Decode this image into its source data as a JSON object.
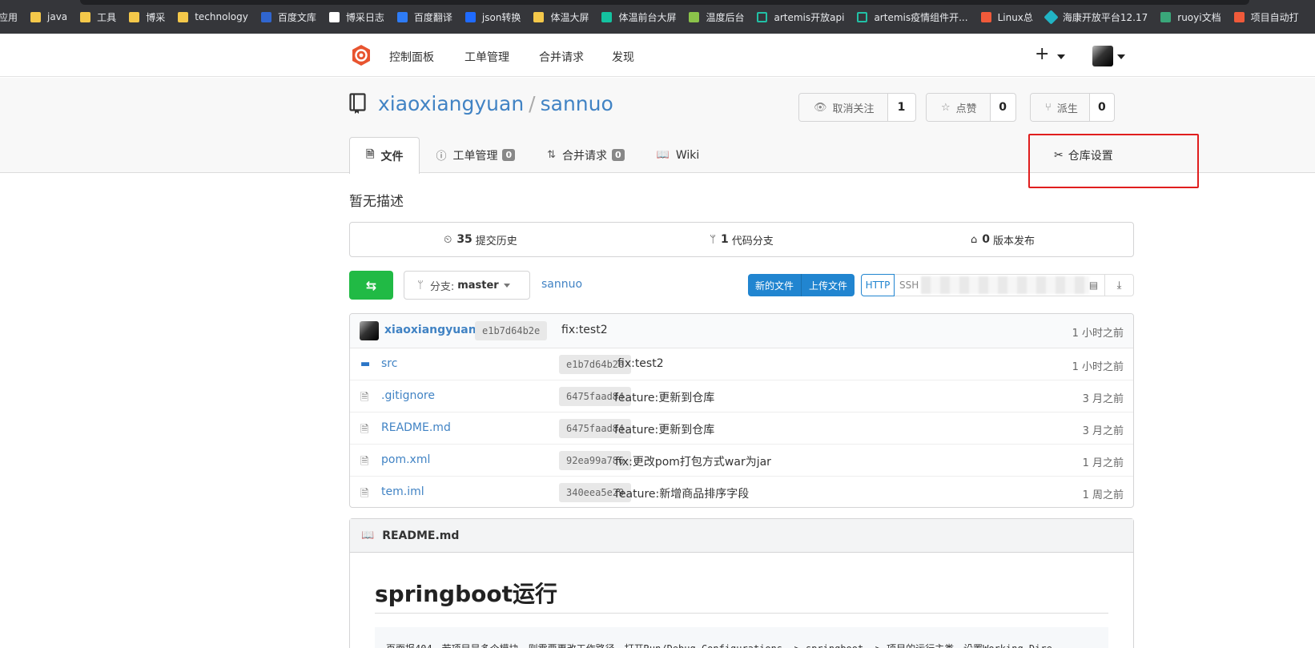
{
  "bookmarks": [
    {
      "label": "应用",
      "icon": "apps-icon"
    },
    {
      "label": "java",
      "icon": "folder-icon"
    },
    {
      "label": "工具",
      "icon": "folder-icon"
    },
    {
      "label": "博采",
      "icon": "folder-icon"
    },
    {
      "label": "technology",
      "icon": "folder-icon"
    },
    {
      "label": "百度文库",
      "icon": "baidu-icon"
    },
    {
      "label": "博采日志",
      "icon": "site-icon"
    },
    {
      "label": "百度翻译",
      "icon": "translate-icon"
    },
    {
      "label": "json转换",
      "icon": "json-icon"
    },
    {
      "label": "体温大屏",
      "icon": "folder-icon"
    },
    {
      "label": "体温前台大屏",
      "icon": "play-icon"
    },
    {
      "label": "温度后台",
      "icon": "leaf-icon"
    },
    {
      "label": "artemis开放api",
      "icon": "ring-icon"
    },
    {
      "label": "artemis疫情组件开...",
      "icon": "ring-icon"
    },
    {
      "label": "Linux总",
      "icon": "csdn-icon"
    },
    {
      "label": "海康开放平台12.17",
      "icon": "cube-icon"
    },
    {
      "label": "ruoyi文档",
      "icon": "ruoyi-icon"
    },
    {
      "label": "项目自动打",
      "icon": "csdn-icon"
    }
  ],
  "nav": {
    "items": [
      "控制面板",
      "工单管理",
      "合并请求",
      "发现"
    ],
    "plus": "+"
  },
  "repo": {
    "owner": "xiaoxiangyuan",
    "separator": "/",
    "name": "sannuo",
    "watch": {
      "label": "取消关注",
      "count": "1"
    },
    "star": {
      "label": "点赞",
      "count": "0"
    },
    "fork": {
      "label": "派生",
      "count": "0"
    },
    "description": "暂无描述"
  },
  "tabs": [
    {
      "label": "文件",
      "icon": "file-icon",
      "count": null
    },
    {
      "label": "工单管理",
      "icon": "issue-icon",
      "count": "0"
    },
    {
      "label": "合并请求",
      "icon": "pull-request-icon",
      "count": "0"
    },
    {
      "label": "Wiki",
      "icon": "book-icon",
      "count": null
    }
  ],
  "settings_tab": {
    "label": "仓库设置"
  },
  "stats": [
    {
      "num": "35",
      "label": "提交历史"
    },
    {
      "num": "1",
      "label": "代码分支"
    },
    {
      "num": "0",
      "label": "版本发布"
    }
  ],
  "branch": {
    "prefix": "分支:",
    "name": "master",
    "path": "sannuo"
  },
  "actions": {
    "new_file": "新的文件",
    "upload": "上传文件",
    "http": "HTTP",
    "ssh": "SSH"
  },
  "last_commit": {
    "author": "xiaoxiangyuan",
    "sha": "e1b7d64b2e",
    "message": "fix:test2",
    "time": "1 小时之前"
  },
  "files": [
    {
      "name": "src",
      "type": "folder",
      "sha": "e1b7d64b2e",
      "message": "fix:test2",
      "time": "1 小时之前"
    },
    {
      "name": ".gitignore",
      "type": "file",
      "sha": "6475faad84",
      "message": "feature:更新到仓库",
      "time": "3 月之前"
    },
    {
      "name": "README.md",
      "type": "file",
      "sha": "6475faad84",
      "message": "feature:更新到仓库",
      "time": "3 月之前"
    },
    {
      "name": "pom.xml",
      "type": "file",
      "sha": "92ea99a786",
      "message": "fix:更改pom打包方式war为jar",
      "time": "1 月之前"
    },
    {
      "name": "tem.iml",
      "type": "file",
      "sha": "340eea5e29",
      "message": "feature:新增商品排序字段",
      "time": "1 周之前"
    }
  ],
  "readme": {
    "title": "README.md",
    "heading": "springboot运行",
    "code_line": "页面报404，若项目是多个模块，则需要更改工作路径，打开Run/Debug Configurations -> springboot -> 项目的运行主类，设置Working Dire"
  }
}
